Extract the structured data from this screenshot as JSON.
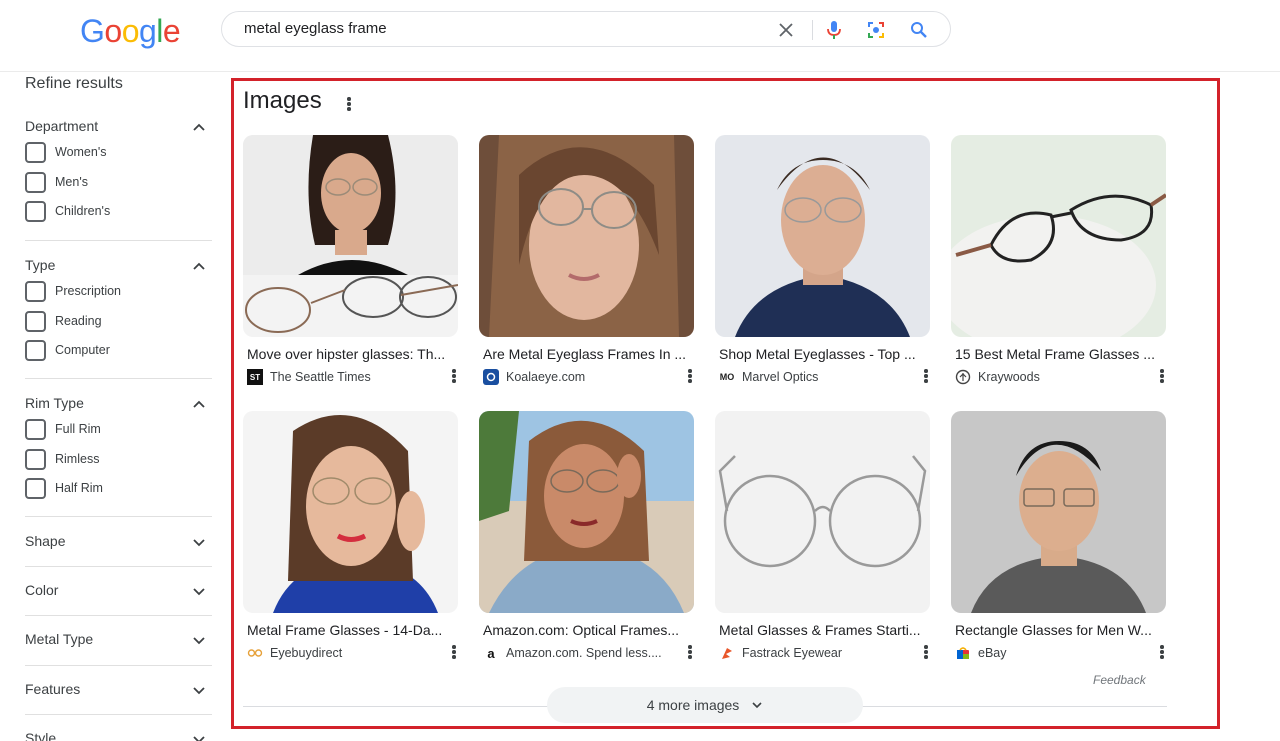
{
  "header": {
    "logo_text": "Google",
    "search_query": "metal eyeglass frame"
  },
  "sidebar": {
    "title": "Refine results",
    "sections": [
      {
        "title": "Department",
        "expanded": true,
        "options": [
          "Women's",
          "Men's",
          "Children's"
        ]
      },
      {
        "title": "Type",
        "expanded": true,
        "options": [
          "Prescription",
          "Reading",
          "Computer"
        ]
      },
      {
        "title": "Rim Type",
        "expanded": true,
        "options": [
          "Full Rim",
          "Rimless",
          "Half Rim"
        ]
      },
      {
        "title": "Shape",
        "expanded": false
      },
      {
        "title": "Color",
        "expanded": false
      },
      {
        "title": "Metal Type",
        "expanded": false
      },
      {
        "title": "Features",
        "expanded": false
      },
      {
        "title": "Style",
        "expanded": false
      }
    ]
  },
  "images": {
    "title": "Images",
    "cards": [
      {
        "title": "Move over hipster glasses: Th...",
        "source": "The Seattle Times"
      },
      {
        "title": "Are Metal Eyeglass Frames In ...",
        "source": "Koalaeye.com"
      },
      {
        "title": "Shop Metal Eyeglasses - Top ...",
        "source": "Marvel Optics"
      },
      {
        "title": "15 Best Metal Frame Glasses ...",
        "source": "Kraywoods"
      },
      {
        "title": "Metal Frame Glasses - 14-Da...",
        "source": "Eyebuydirect"
      },
      {
        "title": "Amazon.com: Optical Frames...",
        "source": "Amazon.com. Spend less...."
      },
      {
        "title": "Metal Glasses & Frames Starti...",
        "source": "Fastrack Eyewear"
      },
      {
        "title": "Rectangle Glasses for Men W...",
        "source": "eBay"
      }
    ],
    "feedback": "Feedback",
    "more_button": "4 more images"
  },
  "colors": {
    "highlight_border": "#d3222a",
    "google_blue": "#4285f4",
    "google_red": "#ea4335",
    "google_yellow": "#fbbc05",
    "google_green": "#34a853"
  }
}
